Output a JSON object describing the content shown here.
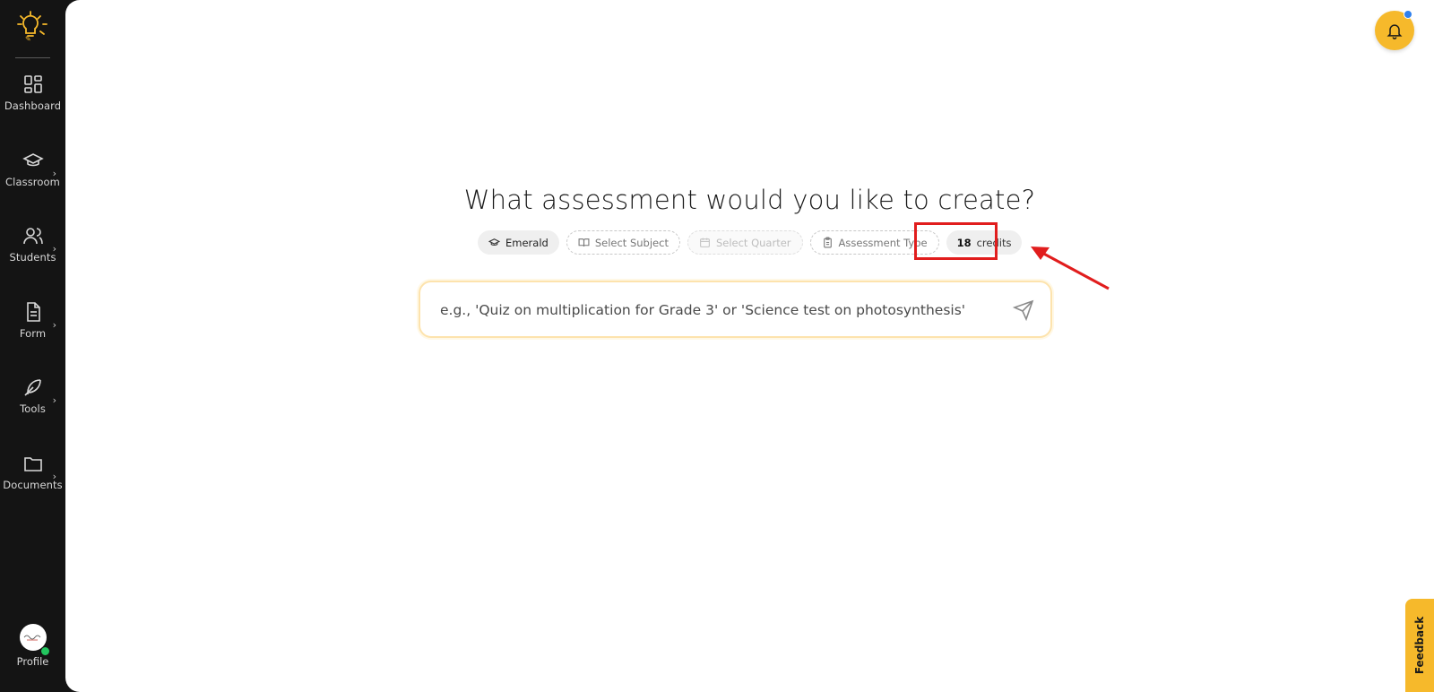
{
  "sidebar": {
    "items": [
      {
        "label": "Dashboard",
        "icon": "dashboard-icon",
        "has_submenu": false
      },
      {
        "label": "Classroom",
        "icon": "graduation-cap-icon",
        "has_submenu": true
      },
      {
        "label": "Students",
        "icon": "users-icon",
        "has_submenu": true
      },
      {
        "label": "Form",
        "icon": "document-icon",
        "has_submenu": true
      },
      {
        "label": "Tools",
        "icon": "feather-icon",
        "has_submenu": true
      },
      {
        "label": "Documents",
        "icon": "folder-icon",
        "has_submenu": true
      }
    ],
    "profile_label": "Profile",
    "chevron": "›"
  },
  "main": {
    "heading": "What assessment would you like to create?",
    "chips": {
      "grade": "Emerald",
      "subject": "Select Subject",
      "quarter": "Select Quarter",
      "type": "Assessment Type",
      "credits_count": "18",
      "credits_label": "credits"
    },
    "prompt_placeholder": "e.g., 'Quiz on multiplication for Grade 3' or 'Science test on photosynthesis'"
  },
  "feedback_label": "Feedback",
  "colors": {
    "sidebar_bg": "#141414",
    "accent_yellow": "#f6b92b",
    "highlight_red": "#e11d1d",
    "notification_dot": "#2f80ed",
    "online_green": "#22c55e"
  }
}
